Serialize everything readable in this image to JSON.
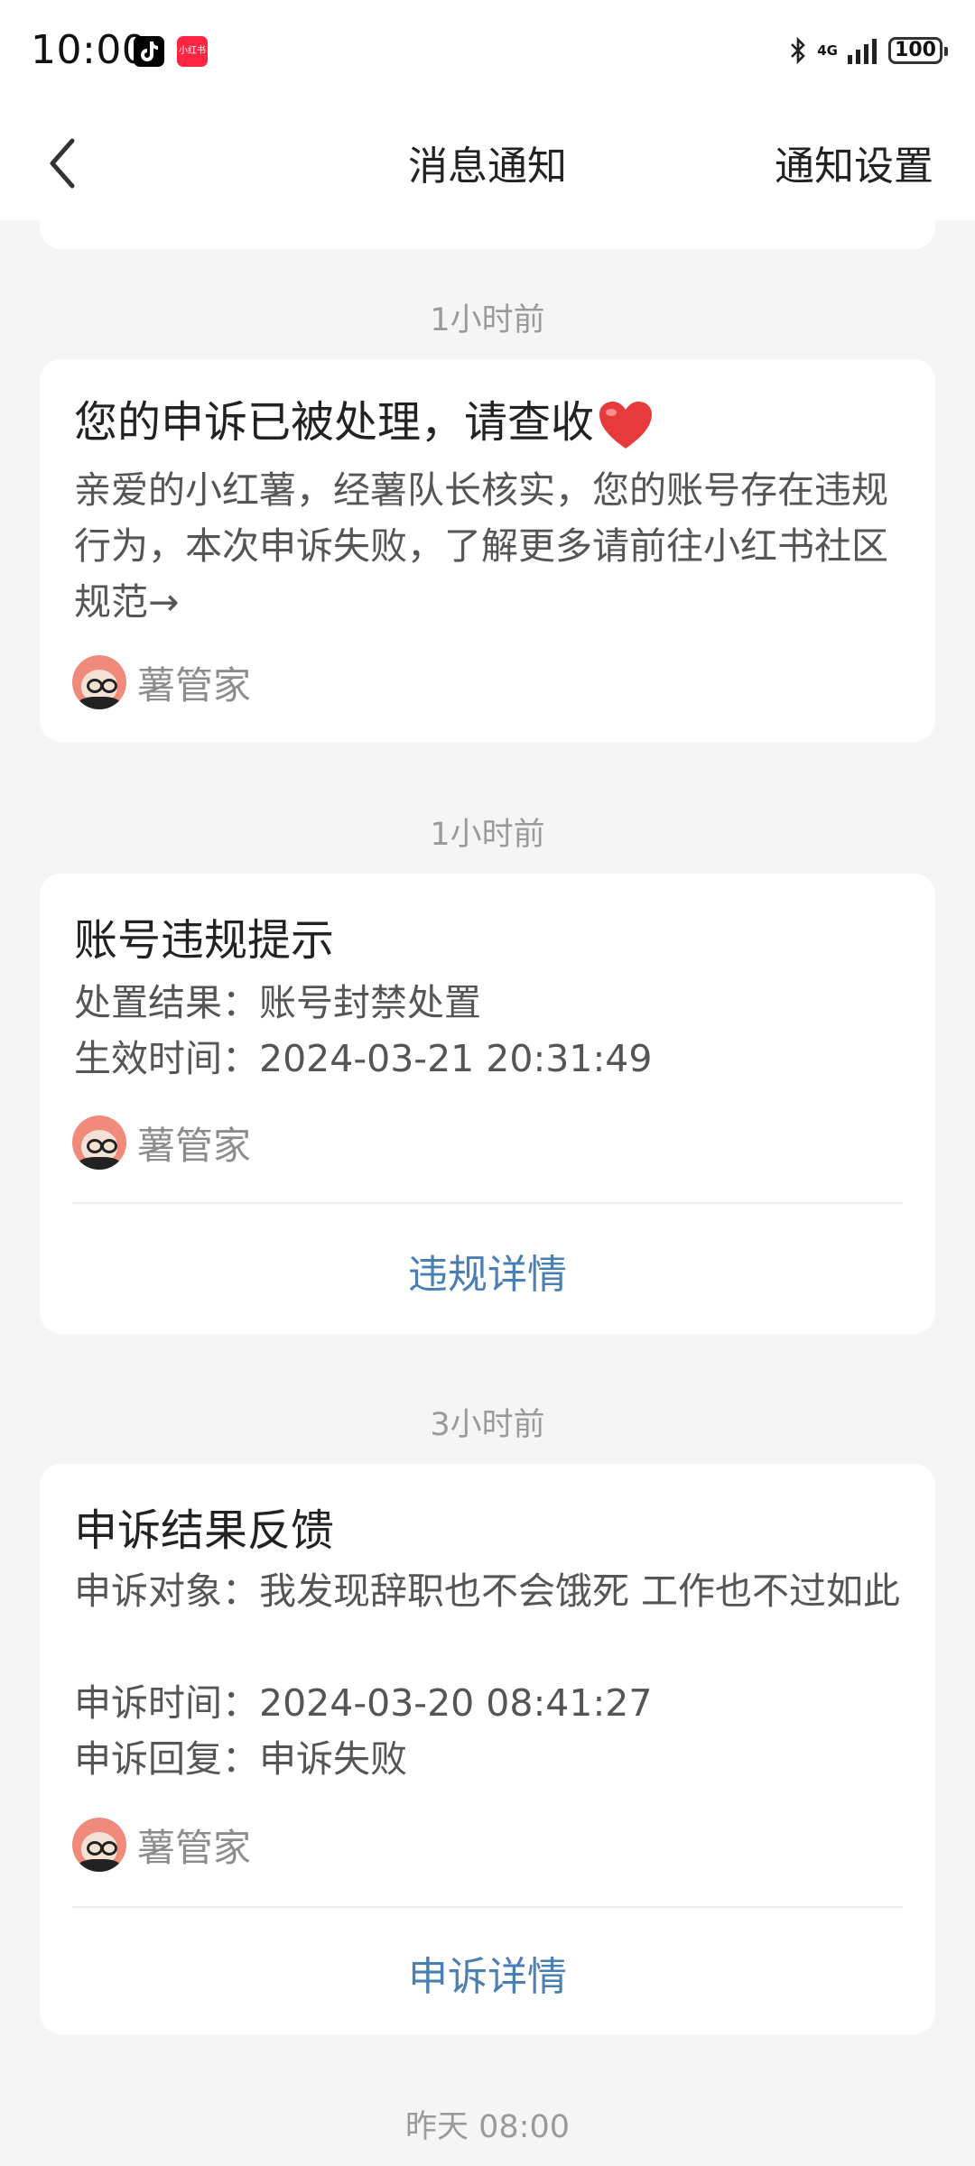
{
  "status_bar": {
    "time": "10:00",
    "app_icons": [
      "tiktok-icon",
      "xiaohongshu-icon"
    ],
    "xhs_icon_text": "小红书",
    "network": "4G",
    "battery": "100"
  },
  "nav": {
    "title": "消息通知",
    "settings": "通知设置",
    "back_icon": "chevron-left-icon"
  },
  "messages": [
    {
      "time": "1小时前",
      "title": "您的申诉已被处理，请查收",
      "title_emoji": "heart-icon",
      "body": "亲爱的小红薯，经薯队长核实，您的账号存在违规行为，本次申诉失败，了解更多请前往小红书社区规范→",
      "sender": "薯管家"
    },
    {
      "time": "1小时前",
      "title": "账号违规提示",
      "lines": [
        "处置结果：账号封禁处置",
        "生效时间：2024-03-21 20:31:49"
      ],
      "sender": "薯管家",
      "action": "违规详情"
    },
    {
      "time": "3小时前",
      "title": "申诉结果反馈",
      "lines": [
        "申诉对象：我发现辞职也不会饿死 工作也不过如此",
        "申诉时间：2024-03-20 08:41:27",
        "申诉回复：申诉失败"
      ],
      "sender": "薯管家",
      "action": "申诉详情"
    }
  ],
  "next_time": "昨天 08:00",
  "colors": {
    "background": "#f5f5f5",
    "link": "#4a7fb5",
    "heart": "#e83a3a"
  }
}
